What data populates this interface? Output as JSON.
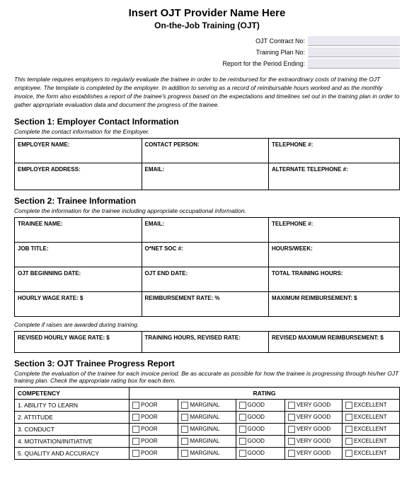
{
  "header": {
    "main_title": "Insert OJT Provider Name Here",
    "sub_title": "On-the-Job Training (OJT)"
  },
  "top_fields": {
    "contract_label": "OJT Contract No:",
    "plan_label": "Training Plan No:",
    "period_label": "Report for the Period Ending:"
  },
  "intro": "This template requires employers to regularly evaluate the trainee in order to be reimbursed for the extraordinary costs of training the OJT employee. The template is completed by the employer.  In addition to serving as a record of reimbursable hours worked and as the monthly invoice, the form also establishes a report of the trainee's progress based on the expectations and timelines set out in the training plan in order to gather appropriate evaluation data and document the progress of the trainee.",
  "section1": {
    "title": "Section 1:  Employer Contact Information",
    "sub": "Complete the contact information for the Employer.",
    "row1": {
      "c1_label": "EMPLOYER NAME:",
      "c2_label": "CONTACT PERSON:",
      "c3_label": "TELEPHONE #:"
    },
    "row2": {
      "c1_label": "EMPLOYER ADDRESS:",
      "c2_label": "EMAIL:",
      "c3_label": "ALTERNATE TELEPHONE  #:"
    }
  },
  "section2": {
    "title": "Section 2:  Trainee Information",
    "sub": "Complete the information for the trainee including appropriate occupational information.",
    "row1": {
      "c1_label": "TRAINEE NAME:",
      "c2_label": "EMAIL:",
      "c3_label": "TELEPHONE #:"
    },
    "row2": {
      "c1_label": "JOB TITLE:",
      "c2_label": "O*NET SOC #:",
      "c3_label": "HOURS/WEEK:"
    },
    "row3": {
      "c1_label": "OJT BEGINNING DATE:",
      "c2_label": "OJT END DATE:",
      "c3_label": "TOTAL TRAINING HOURS:"
    },
    "row4": {
      "c1_label": "HOURLY WAGE RATE: $",
      "c2_label": "REIMBURSEMENT RATE:      %",
      "c3_label": "MAXIMUM REIMBURSEMENT: $"
    },
    "raises_sub": "Complete if raises are awarded during training.",
    "row5": {
      "c1_label": "REVISED HOURLY WAGE RATE: $",
      "c2_label": "TRAINING HOURS, REVISED RATE:",
      "c3_label": "REVISED MAXIMUM REIMBURSEMENT: $"
    }
  },
  "section3": {
    "title": "Section 3:  OJT Trainee Progress Report",
    "sub": "Complete the evaluation of the trainee for each invoice period.  Be as accurate as possible for how the trainee is progressing through his/her OJT training plan.  Check the appropriate rating box for each item.",
    "competency_header": "COMPETENCY",
    "rating_header": "RATING",
    "ratings": [
      "POOR",
      "MARGINAL",
      "GOOD",
      "VERY GOOD",
      "EXCELLENT"
    ],
    "items": [
      {
        "num": "1.",
        "label": "ABILITY TO LEARN"
      },
      {
        "num": "2.",
        "label": "ATTITUDE"
      },
      {
        "num": "3.",
        "label": "CONDUCT"
      },
      {
        "num": "4.",
        "label": "MOTIVATION/INITIATIVE"
      },
      {
        "num": "5.",
        "label": "QUALITY AND ACCURACY"
      }
    ]
  }
}
